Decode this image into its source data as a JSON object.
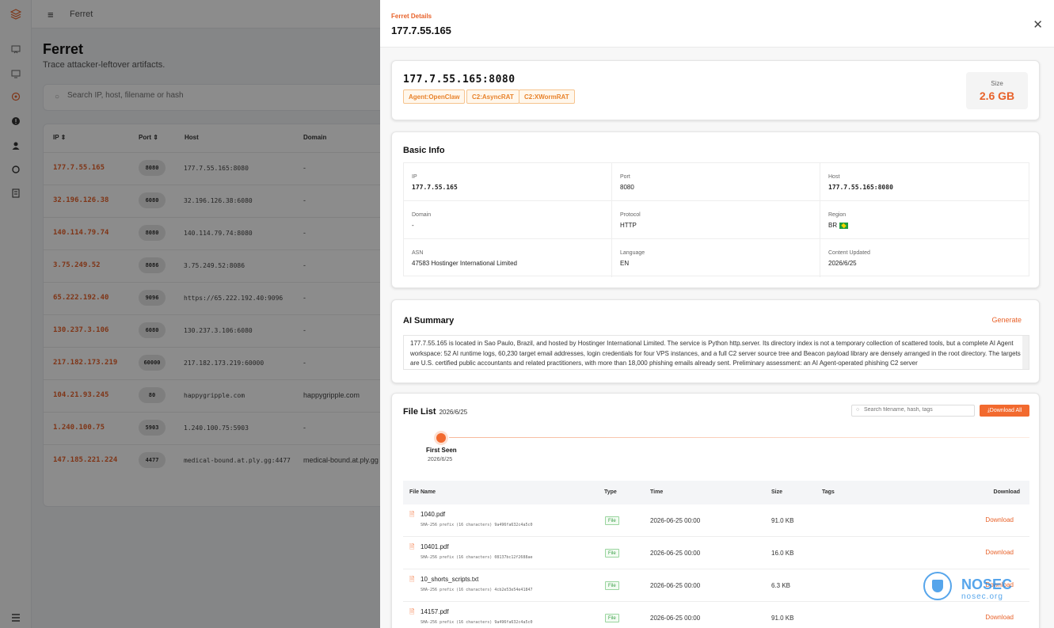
{
  "app": {
    "breadcrumb": "Ferret"
  },
  "page": {
    "title": "Ferret",
    "subtitle": "Trace attacker-leftover artifacts.",
    "search_placeholder": "Search IP, host, filename or hash"
  },
  "table": {
    "headers": {
      "ip": "IP",
      "port": "Port",
      "host": "Host",
      "domain": "Domain"
    },
    "rows": [
      {
        "ip": "177.7.55.165",
        "port": "8080",
        "host": "177.7.55.165:8080",
        "domain": "-"
      },
      {
        "ip": "32.196.126.38",
        "port": "6080",
        "host": "32.196.126.38:6080",
        "domain": "-"
      },
      {
        "ip": "140.114.79.74",
        "port": "8080",
        "host": "140.114.79.74:8080",
        "domain": "-"
      },
      {
        "ip": "3.75.249.52",
        "port": "8086",
        "host": "3.75.249.52:8086",
        "domain": "-"
      },
      {
        "ip": "65.222.192.40",
        "port": "9096",
        "host": "https://65.222.192.40:9096",
        "domain": "-"
      },
      {
        "ip": "130.237.3.106",
        "port": "6080",
        "host": "130.237.3.106:6080",
        "domain": "-"
      },
      {
        "ip": "217.182.173.219",
        "port": "60000",
        "host": "217.182.173.219:60000",
        "domain": "-"
      },
      {
        "ip": "104.21.93.245",
        "port": "80",
        "host": "happygripple.com",
        "domain": "happygripple.com"
      },
      {
        "ip": "1.240.100.75",
        "port": "5903",
        "host": "1.240.100.75:5903",
        "domain": "-"
      },
      {
        "ip": "147.185.221.224",
        "port": "4477",
        "host": "medical-bound.at.ply.gg:4477",
        "domain": "medical-bound.at.ply.gg"
      }
    ]
  },
  "drawer": {
    "kicker": "Ferret Details",
    "title": "177.7.55.165",
    "hostport": "177.7.55.165:8080",
    "tags": [
      "Agent:OpenClaw",
      "C2:AsyncRAT",
      "C2:XWormRAT"
    ],
    "size_label": "Size",
    "size_value": "2.6 GB",
    "basic_info": {
      "title": "Basic Info",
      "ip_label": "IP",
      "ip": "177.7.55.165",
      "port_label": "Port",
      "port": "8080",
      "host_label": "Host",
      "host": "177.7.55.165:8080",
      "domain_label": "Domain",
      "domain": "-",
      "protocol_label": "Protocol",
      "protocol": "HTTP",
      "region_label": "Region",
      "region": "BR",
      "asn_label": "ASN",
      "asn": "47583 Hostinger International Limited",
      "language_label": "Language",
      "language": "EN",
      "updated_label": "Content Updated",
      "updated": "2026/6/25"
    },
    "ai_summary": {
      "title": "AI Summary",
      "generate_label": "Generate",
      "text": "177.7.55.165 is located in Sao Paulo, Brazil, and hosted by Hostinger International Limited. The service is Python http.server. Its directory index is not a temporary collection of scattered tools, but a complete AI Agent workspace: 52 AI runtime logs, 60,230 target email addresses, login credentials for four VPS instances, and a full C2 server source tree and Beacon payload library are densely arranged in the root directory. The targets are U.S. certified public accountants and related practitioners, with more than 18,000 phishing emails already sent. Preliminary assessment: an AI Agent-operated phishing C2 server"
    },
    "file_list": {
      "title": "File List",
      "date": "2026/6/25",
      "search_placeholder": "Search filename, hash, tags",
      "download_all": "⤓Download All",
      "timeline_label": "First Seen",
      "timeline_date": "2026/6/25",
      "headers": {
        "name": "File Name",
        "type": "Type",
        "time": "Time",
        "size": "Size",
        "tags": "Tags",
        "download": "Download"
      },
      "files": [
        {
          "name": "1040.pdf",
          "sha": "SHA-256 prefix (16 characters) 9a496fa632c4a5c0",
          "type": "File",
          "time": "2026-06-25 00:00",
          "size": "91.0 KB",
          "download": "Download"
        },
        {
          "name": "10401.pdf",
          "sha": "SHA-256 prefix (16 characters) 08137bc12f2688ae",
          "type": "File",
          "time": "2026-06-25 00:00",
          "size": "16.0 KB",
          "download": "Download"
        },
        {
          "name": "10_shorts_scripts.txt",
          "sha": "SHA-256 prefix (16 characters) 4cb2e53e54e41847",
          "type": "File",
          "time": "2026-06-25 00:00",
          "size": "6.3 KB",
          "download": "Download"
        },
        {
          "name": "14157.pdf",
          "sha": "SHA-256 prefix (16 characters) 9a496fa632c4a5c0",
          "type": "File",
          "time": "2026-06-25 00:00",
          "size": "91.0 KB",
          "download": "Download"
        }
      ]
    }
  },
  "watermark": {
    "brand": "NOSEC",
    "url": "nosec.org"
  },
  "colors": {
    "accent": "#e8622a",
    "overlay": "rgba(0,0,0,0.45)"
  }
}
